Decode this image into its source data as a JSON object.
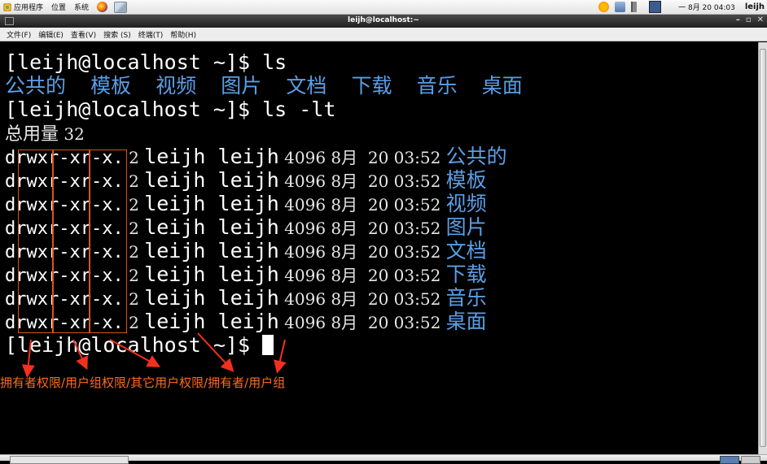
{
  "panel": {
    "menus": [
      "应用程序",
      "位置",
      "系统"
    ],
    "clock": "一 8月 20 04:03",
    "user": "leijh"
  },
  "window": {
    "title": "leijh@localhost:~",
    "controls": [
      "–",
      "▫",
      "✕"
    ]
  },
  "menubar": [
    "文件(F)",
    "编辑(E)",
    "查看(V)",
    "搜索 (S)",
    "终端(T)",
    "帮助(H)"
  ],
  "terminal": {
    "prompt": "[leijh@localhost ~]$ ",
    "cmd1": "ls",
    "dirs_line": "公共的  模板  视频  图片  文档  下载  音乐  桌面",
    "cmd2": "ls -lt",
    "total_label": "总用量",
    "total_value": " 32",
    "entries": [
      {
        "perm_type": "d",
        "perm_owner": "rwx",
        "perm_group": "r-x",
        "perm_other": "r-x",
        "dot": ".",
        "links": " 2 ",
        "owner": "leijh",
        "group": "leijh",
        "size": " 4096 8月  20 03:52 ",
        "name": "公共的"
      },
      {
        "perm_type": "d",
        "perm_owner": "rwx",
        "perm_group": "r-x",
        "perm_other": "r-x",
        "dot": ".",
        "links": " 2 ",
        "owner": "leijh",
        "group": "leijh",
        "size": " 4096 8月  20 03:52 ",
        "name": "模板"
      },
      {
        "perm_type": "d",
        "perm_owner": "rwx",
        "perm_group": "r-x",
        "perm_other": "r-x",
        "dot": ".",
        "links": " 2 ",
        "owner": "leijh",
        "group": "leijh",
        "size": " 4096 8月  20 03:52 ",
        "name": "视频"
      },
      {
        "perm_type": "d",
        "perm_owner": "rwx",
        "perm_group": "r-x",
        "perm_other": "r-x",
        "dot": ".",
        "links": " 2 ",
        "owner": "leijh",
        "group": "leijh",
        "size": " 4096 8月  20 03:52 ",
        "name": "图片"
      },
      {
        "perm_type": "d",
        "perm_owner": "rwx",
        "perm_group": "r-x",
        "perm_other": "r-x",
        "dot": ".",
        "links": " 2 ",
        "owner": "leijh",
        "group": "leijh",
        "size": " 4096 8月  20 03:52 ",
        "name": "文档"
      },
      {
        "perm_type": "d",
        "perm_owner": "rwx",
        "perm_group": "r-x",
        "perm_other": "r-x",
        "dot": ".",
        "links": " 2 ",
        "owner": "leijh",
        "group": "leijh",
        "size": " 4096 8月  20 03:52 ",
        "name": "下载"
      },
      {
        "perm_type": "d",
        "perm_owner": "rwx",
        "perm_group": "r-x",
        "perm_other": "r-x",
        "dot": ".",
        "links": " 2 ",
        "owner": "leijh",
        "group": "leijh",
        "size": " 4096 8月  20 03:52 ",
        "name": "音乐"
      },
      {
        "perm_type": "d",
        "perm_owner": "rwx",
        "perm_group": "r-x",
        "perm_other": "r-x",
        "dot": ".",
        "links": " 2 ",
        "owner": "leijh",
        "group": "leijh",
        "size": " 4096 8月  20 03:52 ",
        "name": "桌面"
      }
    ]
  },
  "annotation": {
    "text": "拥有者权限/用户组权限/其它用户权限/拥有者/用户组",
    "color": "#ff6a1a"
  },
  "colors": {
    "dir_blue": "#5b9ee6",
    "box_orange": "#d8551c"
  }
}
